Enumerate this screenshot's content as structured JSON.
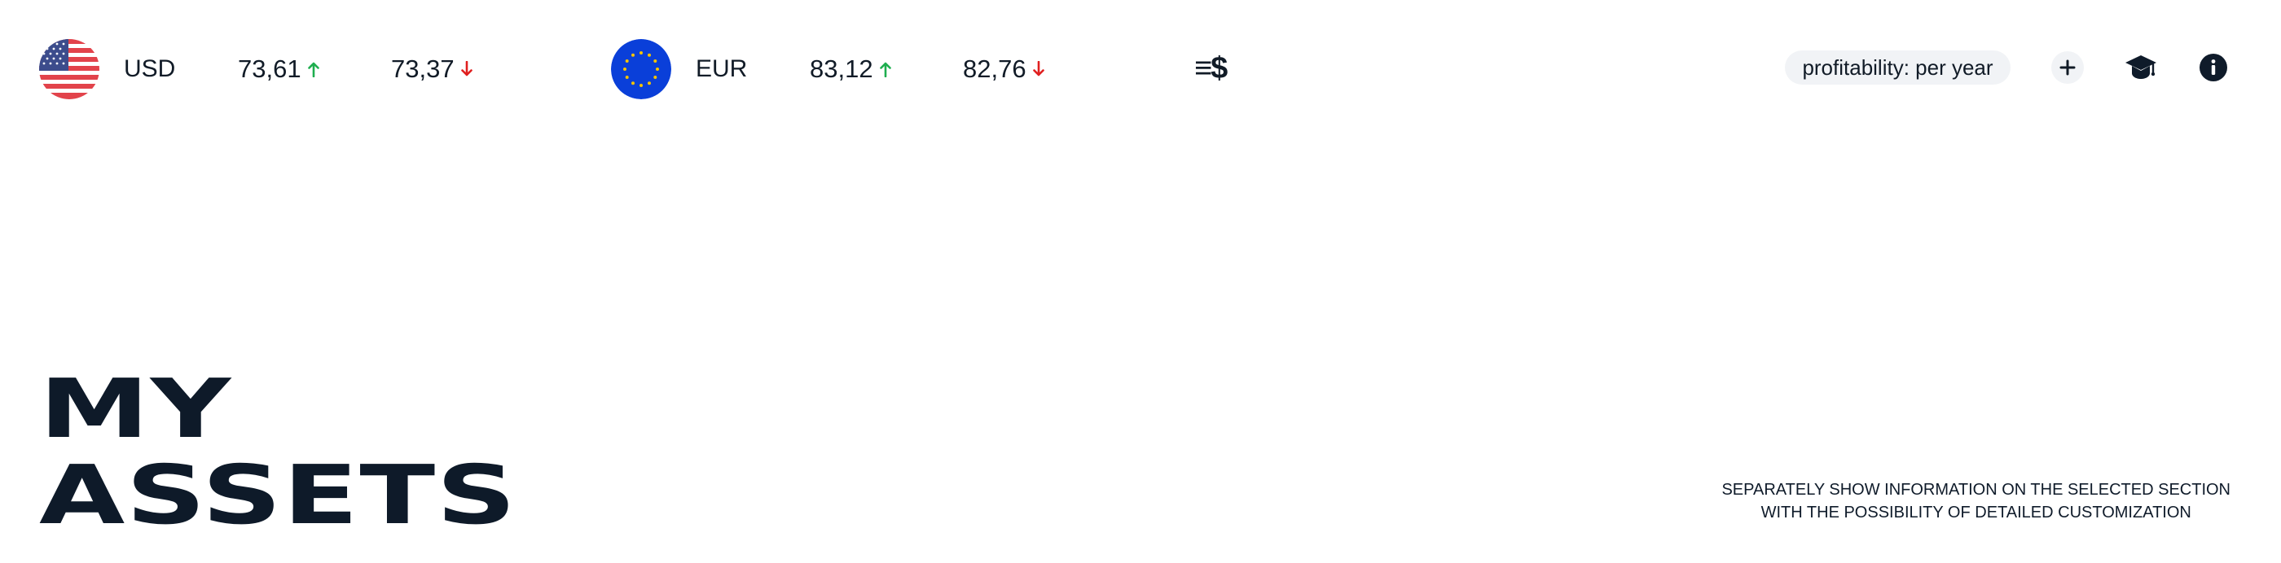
{
  "currencies": [
    {
      "code": "USD",
      "buy": "73,61",
      "sell": "73,37",
      "flag": "us-flag-icon"
    },
    {
      "code": "EUR",
      "buy": "83,12",
      "sell": "82,76",
      "flag": "eu-flag-icon"
    }
  ],
  "toolbar": {
    "converter_label": "≡$",
    "profitability_label": "profitability: per year",
    "add_icon": "plus-icon",
    "education_icon": "graduation-cap-icon",
    "info_icon": "info-icon"
  },
  "title": {
    "line1": "MY",
    "line2": "ASSETS"
  },
  "note": {
    "line1": "SEPARATELY SHOW INFORMATION ON THE SELECTED SECTION",
    "line2": "WITH THE POSSIBILITY OF DETAILED CUSTOMIZATION"
  },
  "colors": {
    "up": "#1fae4f",
    "down": "#e02020",
    "text": "#0f1b2a",
    "pill_bg": "#f1f3f6",
    "eu_blue": "#0a3fd9",
    "eu_star": "#f5c400"
  }
}
